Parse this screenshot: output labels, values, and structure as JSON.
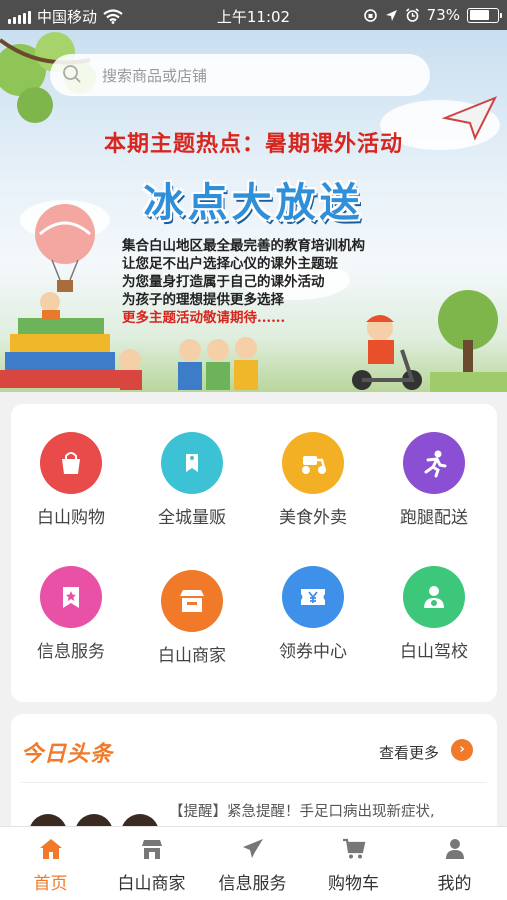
{
  "status_bar": {
    "carrier": "中国移动",
    "time": "上午11:02",
    "battery": "73%",
    "battery_level": 0.73
  },
  "search": {
    "placeholder": "搜索商品或店铺"
  },
  "banner": {
    "headline": "本期主题热点：暑期课外活动",
    "title": "冰点大放送",
    "lines": [
      "集合白山地区最全最完善的教育培训机构",
      "让您足不出户选择心仪的课外主题班",
      "为您量身打造属于自己的课外活动",
      "为孩子的理想提供更多选择"
    ],
    "note": "更多主题活动敬请期待......"
  },
  "categories": [
    {
      "label": "白山购物",
      "icon": "shopping-bag-icon",
      "color": "#e94a4a"
    },
    {
      "label": "全城量贩",
      "icon": "price-tag-icon",
      "color": "#3cc2d4"
    },
    {
      "label": "美食外卖",
      "icon": "scooter-icon",
      "color": "#f4b024"
    },
    {
      "label": "跑腿配送",
      "icon": "runner-icon",
      "color": "#8b4fd4"
    },
    {
      "label": "信息服务",
      "icon": "bookmark-icon",
      "color": "#e851a6"
    },
    {
      "label": "白山商家",
      "icon": "store-icon",
      "color": "#f07a2a"
    },
    {
      "label": "领券中心",
      "icon": "coupon-icon",
      "color": "#3e90e8"
    },
    {
      "label": "白山驾校",
      "icon": "driver-icon",
      "color": "#3cc77a"
    }
  ],
  "news": {
    "title": "今日头条",
    "more_label": "查看更多",
    "item_text": "【提醒】紧急提醒！手足口病出现新症状,"
  },
  "tabs": [
    {
      "label": "首页",
      "icon": "home-icon",
      "active": true
    },
    {
      "label": "白山商家",
      "icon": "store-icon",
      "active": false
    },
    {
      "label": "信息服务",
      "icon": "paper-plane-icon",
      "active": false
    },
    {
      "label": "购物车",
      "icon": "cart-icon",
      "active": false
    },
    {
      "label": "我的",
      "icon": "user-icon",
      "active": false
    }
  ]
}
